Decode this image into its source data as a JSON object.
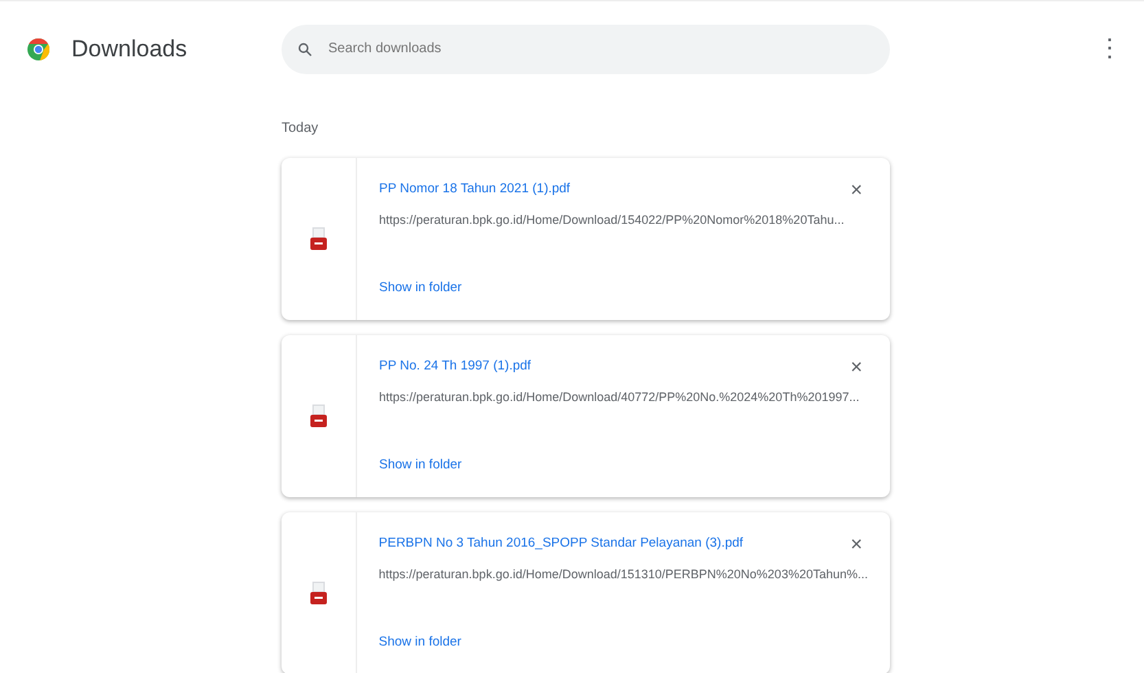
{
  "header": {
    "title": "Downloads",
    "search": {
      "placeholder": "Search downloads"
    },
    "menu": "⋮"
  },
  "section": "Today",
  "downloads": [
    {
      "file_name": "PP Nomor 18 Tahun 2021 (1).pdf",
      "url": "https://peraturan.bpk.go.id/Home/Download/154022/PP%20Nomor%2018%20Tahu...",
      "action": "Show in folder",
      "close": "×"
    },
    {
      "file_name": "PP No. 24 Th 1997 (1).pdf",
      "url": "https://peraturan.bpk.go.id/Home/Download/40772/PP%20No.%2024%20Th%201997...",
      "action": "Show in folder",
      "close": "×"
    },
    {
      "file_name": "PERBPN No 3 Tahun 2016_SPOPP Standar Pelayanan (3).pdf",
      "url": "https://peraturan.bpk.go.id/Home/Download/151310/PERBPN%20No%203%20Tahun%...",
      "action": "Show in folder",
      "close": "×"
    }
  ]
}
